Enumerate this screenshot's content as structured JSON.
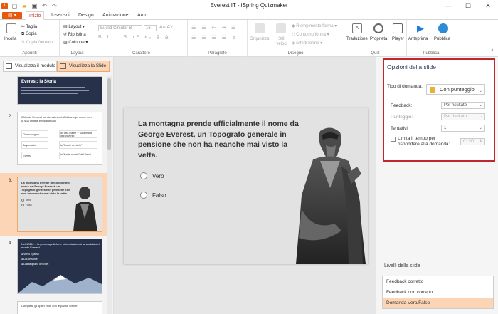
{
  "window": {
    "title": "Everest IT - iSpring Quizmaker"
  },
  "tabs": {
    "file": "▤ ▾",
    "items": [
      "Inizio",
      "Inserisci",
      "Design",
      "Animazione",
      "Auto"
    ],
    "active": 0
  },
  "ribbon": {
    "appunti": {
      "label": "Appunti",
      "incolla": "Incolla",
      "taglia": "Taglia",
      "copia": "Copia",
      "copia_formato": "Copia formato"
    },
    "layout": {
      "label": "Layout",
      "layout": "Layout",
      "ripristina": "Ripristina",
      "colonne": "Colonne"
    },
    "carattere": {
      "label": "Carattere",
      "font": "Euclid Circular B",
      "size": "16"
    },
    "paragrafo": {
      "label": "Paragrafo"
    },
    "disegno": {
      "label": "Disegno",
      "organizza": "Organizza",
      "stili_veloci": "Stili veloci",
      "riempimento": "Riempimento forma",
      "contorno": "Contorno forma",
      "effetti": "Effetti forme"
    },
    "quiz": {
      "label": "Quiz",
      "traduzione": "Traduzione",
      "proprieta": "Proprietà",
      "player": "Player"
    },
    "pubblica": {
      "label": "Pubblica",
      "anteprima": "Anteprima",
      "pubblica": "Pubblica"
    }
  },
  "leftpanel": {
    "view_module": "Visualizza il modulo",
    "view_slide": "Visualizza la Slide"
  },
  "thumbnails": [
    {
      "num": "",
      "title": "Everest: la Storia"
    },
    {
      "num": "2.",
      "text": "Il Monte Everest ha diversi nomi. Abbina ogni nome con la sua origine e il significato",
      "rows": [
        [
          "Chomolungma",
          "la \"Dea madre\" / \"Dea madre dell'universo\""
        ],
        [
          "Sagarmatha",
          "la \"Fronte del cielo\""
        ],
        [
          "Everest",
          "la \"fronte al cielo\" del Nepal"
        ]
      ]
    },
    {
      "num": "3.",
      "text": "La montagna prende ufficialmente il nome da George Everest, un Topografo generale in pensione che non ha neanche mai visto la vetta.",
      "options": [
        "Vero",
        "Falso"
      ]
    },
    {
      "num": "4.",
      "text": "Nel 1921 … la prima spedizione britannica tentò la scalata del monte Everest.",
      "options": [
        "Verso il passo",
        "Dal versante",
        "Dall'altopiano del Tibet"
      ]
    },
    {
      "num": "",
      "text": "Completa gli spazi vuoti con le parole fornite"
    }
  ],
  "slide": {
    "question": "La montagna prende ufficialmente il nome da George Everest, un Topografo generale in pensione che non ha neanche mai visto la vetta.",
    "options": [
      "Vero",
      "Falso"
    ]
  },
  "options_panel": {
    "title": "Opzioni della slide",
    "tipo_label": "Tipo di domanda:",
    "tipo_value": "Con punteggio",
    "feedback_label": "Feedback:",
    "feedback_value": "Per risultato",
    "punteggio_label": "Punteggio:",
    "punteggio_value": "Per risultato",
    "tentativi_label": "Tentativi:",
    "tentativi_value": "1",
    "limite_label": "Limita il tempo per rispondere alla domanda:",
    "limite_value": "01:00"
  },
  "levels": {
    "title": "Livelli della slide",
    "items": [
      "Feedback corretto",
      "Feedback non corretto",
      "Domanda Vero/Falso"
    ],
    "active": 2
  }
}
